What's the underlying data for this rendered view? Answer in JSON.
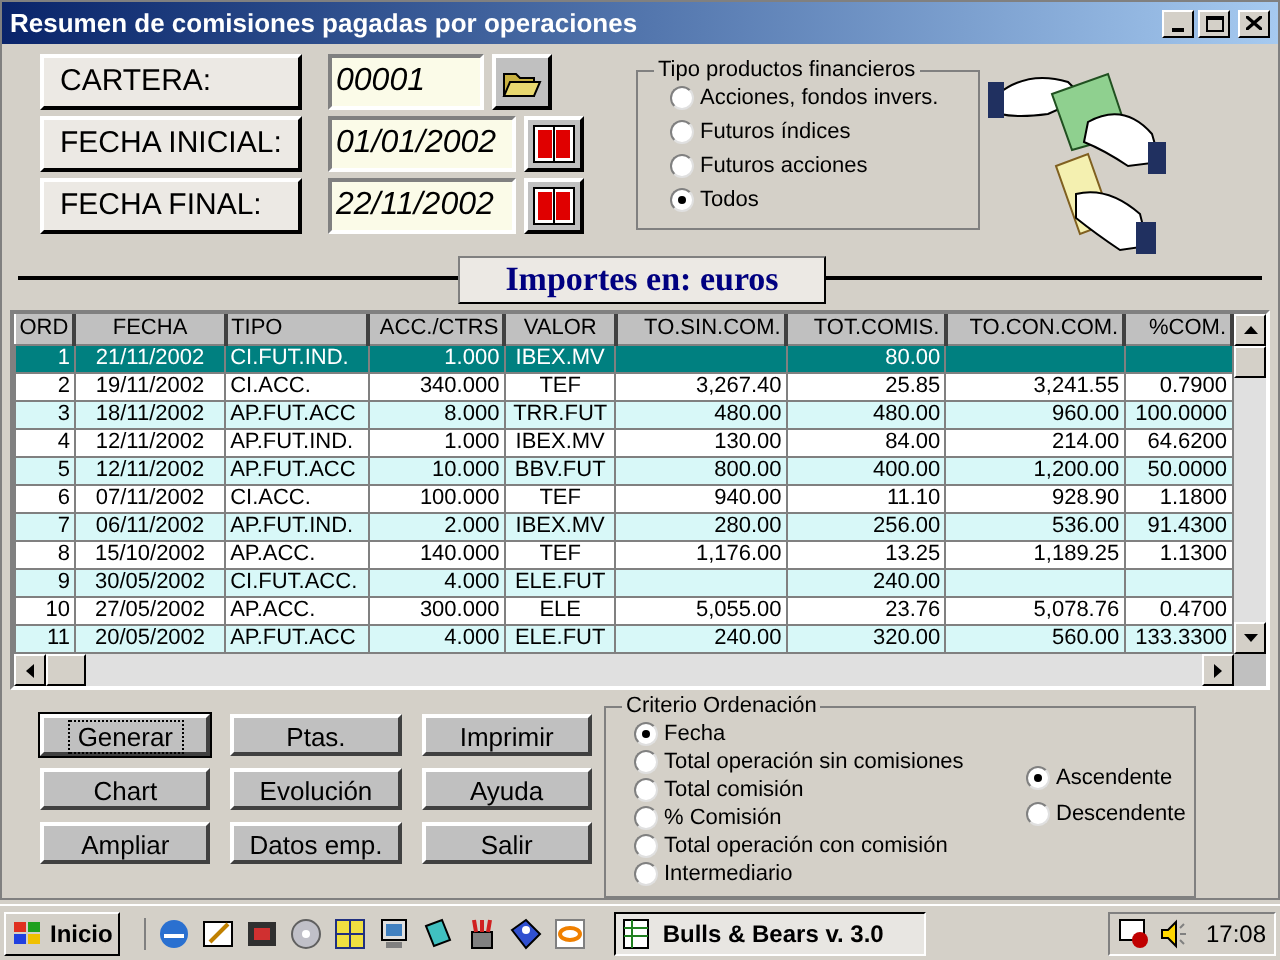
{
  "window": {
    "title": "Resumen de comisiones pagadas por operaciones"
  },
  "fields": [
    {
      "label": "CARTERA:",
      "value": "00001",
      "kind": "folder"
    },
    {
      "label": "FECHA INICIAL:",
      "value": "01/01/2002",
      "kind": "calendar"
    },
    {
      "label": "FECHA FINAL:",
      "value": "22/11/2002",
      "kind": "calendar"
    }
  ],
  "product_type": {
    "title": "Tipo productos financieros",
    "options": [
      {
        "label": "Acciones, fondos invers.",
        "selected": false
      },
      {
        "label": "Futuros índices",
        "selected": false
      },
      {
        "label": "Futuros acciones",
        "selected": false
      },
      {
        "label": "Todos",
        "selected": true
      }
    ]
  },
  "currency_banner": "Importes en: euros",
  "table": {
    "columns": [
      "ORD",
      "FECHA",
      "TIPO",
      "ACC./CTRS",
      "VALOR",
      "TO.SIN.COM.",
      "TOT.COMIS.",
      "TO.CON.COM.",
      "%COM."
    ],
    "rows": [
      {
        "selected": true,
        "cells": [
          "1",
          "21/11/2002",
          "CI.FUT.IND.",
          "1.000",
          "IBEX.MV",
          "",
          "80.00",
          "",
          ""
        ]
      },
      {
        "selected": false,
        "cells": [
          "2",
          "19/11/2002",
          "CI.ACC.",
          "340.000",
          "TEF",
          "3,267.40",
          "25.85",
          "3,241.55",
          "0.7900"
        ]
      },
      {
        "selected": false,
        "cells": [
          "3",
          "18/11/2002",
          "AP.FUT.ACC",
          "8.000",
          "TRR.FUT",
          "480.00",
          "480.00",
          "960.00",
          "100.0000"
        ]
      },
      {
        "selected": false,
        "cells": [
          "4",
          "12/11/2002",
          "AP.FUT.IND.",
          "1.000",
          "IBEX.MV",
          "130.00",
          "84.00",
          "214.00",
          "64.6200"
        ]
      },
      {
        "selected": false,
        "cells": [
          "5",
          "12/11/2002",
          "AP.FUT.ACC",
          "10.000",
          "BBV.FUT",
          "800.00",
          "400.00",
          "1,200.00",
          "50.0000"
        ]
      },
      {
        "selected": false,
        "cells": [
          "6",
          "07/11/2002",
          "CI.ACC.",
          "100.000",
          "TEF",
          "940.00",
          "11.10",
          "928.90",
          "1.1800"
        ]
      },
      {
        "selected": false,
        "cells": [
          "7",
          "06/11/2002",
          "AP.FUT.IND.",
          "2.000",
          "IBEX.MV",
          "280.00",
          "256.00",
          "536.00",
          "91.4300"
        ]
      },
      {
        "selected": false,
        "cells": [
          "8",
          "15/10/2002",
          "AP.ACC.",
          "140.000",
          "TEF",
          "1,176.00",
          "13.25",
          "1,189.25",
          "1.1300"
        ]
      },
      {
        "selected": false,
        "cells": [
          "9",
          "30/05/2002",
          "CI.FUT.ACC.",
          "4.000",
          "ELE.FUT",
          "",
          "240.00",
          "",
          ""
        ]
      },
      {
        "selected": false,
        "cells": [
          "10",
          "27/05/2002",
          "AP.ACC.",
          "300.000",
          "ELE",
          "5,055.00",
          "23.76",
          "5,078.76",
          "0.4700"
        ]
      },
      {
        "selected": false,
        "cells": [
          "11",
          "20/05/2002",
          "AP.FUT.ACC",
          "4.000",
          "ELE.FUT",
          "240.00",
          "320.00",
          "560.00",
          "133.3300"
        ]
      }
    ]
  },
  "buttons": [
    {
      "label": "Generar",
      "focused": true
    },
    {
      "label": "Ptas.",
      "focused": false
    },
    {
      "label": "Imprimir",
      "focused": false
    },
    {
      "label": "Chart",
      "focused": false
    },
    {
      "label": "Evolución",
      "focused": false
    },
    {
      "label": "Ayuda",
      "focused": false
    },
    {
      "label": "Ampliar",
      "focused": false
    },
    {
      "label": "Datos emp.",
      "focused": false
    },
    {
      "label": "Salir",
      "focused": false
    }
  ],
  "sort": {
    "title": "Criterio Ordenación",
    "criteria": [
      {
        "label": "Fecha",
        "selected": true
      },
      {
        "label": "Total operación sin comisiones",
        "selected": false
      },
      {
        "label": "Total comisión",
        "selected": false
      },
      {
        "label": "% Comisión",
        "selected": false
      },
      {
        "label": "Total operación con comisión",
        "selected": false
      },
      {
        "label": "Intermediario",
        "selected": false
      }
    ],
    "order": [
      {
        "label": "Ascendente",
        "selected": true
      },
      {
        "label": "Descendente",
        "selected": false
      }
    ]
  },
  "taskbar": {
    "start": "Inicio",
    "task": "Bulls & Bears v. 3.0",
    "clock": "17:08"
  }
}
